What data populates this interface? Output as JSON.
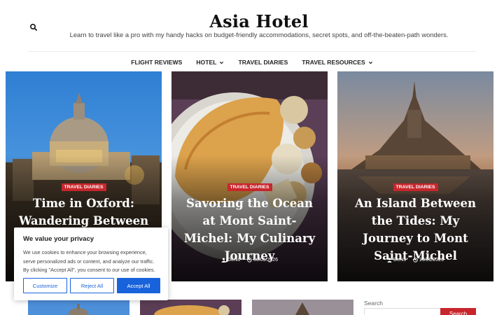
{
  "site": {
    "title": "Asia Hotel",
    "tagline": "Learn to travel like a pro with my handy hacks on budget-friendly accommodations, secret spots, and off-the-beaten-path wonders."
  },
  "nav": {
    "items": [
      {
        "label": "FLIGHT REVIEWS",
        "has_dropdown": false
      },
      {
        "label": "HOTEL",
        "has_dropdown": true
      },
      {
        "label": "TRAVEL DIARIES",
        "has_dropdown": false
      },
      {
        "label": "TRAVEL RESOURCES",
        "has_dropdown": true
      }
    ]
  },
  "posts": [
    {
      "category": "TRAVEL DIARIES",
      "title": "Time in Oxford: Wandering Between",
      "author": "",
      "date": ""
    },
    {
      "category": "TRAVEL DIARIES",
      "title": "Savoring the Ocean at Mont Saint-Michel: My Culinary Journey",
      "author": "Denis",
      "date": "30/06/2026"
    },
    {
      "category": "TRAVEL DIARIES",
      "title": "An Island Between the Tides: My Journey to Mont Saint-Michel",
      "author": "Denis",
      "date": "10/06/2026"
    }
  ],
  "cookie": {
    "title": "We value your privacy",
    "text": "We use cookies to enhance your browsing experience, serve personalized ads or content, and analyze our traffic. By clicking \"Accept All\", you consent to our use of cookies.",
    "customize": "Customize",
    "reject": "Reject All",
    "accept": "Accept All"
  },
  "sidebar": {
    "search_label": "Search",
    "search_button": "Search"
  },
  "colors": {
    "accent": "#c8262c",
    "cookie_blue": "#1863dc"
  },
  "icons": [
    "search-icon",
    "chevron-down-icon",
    "user-icon",
    "clock-icon"
  ]
}
